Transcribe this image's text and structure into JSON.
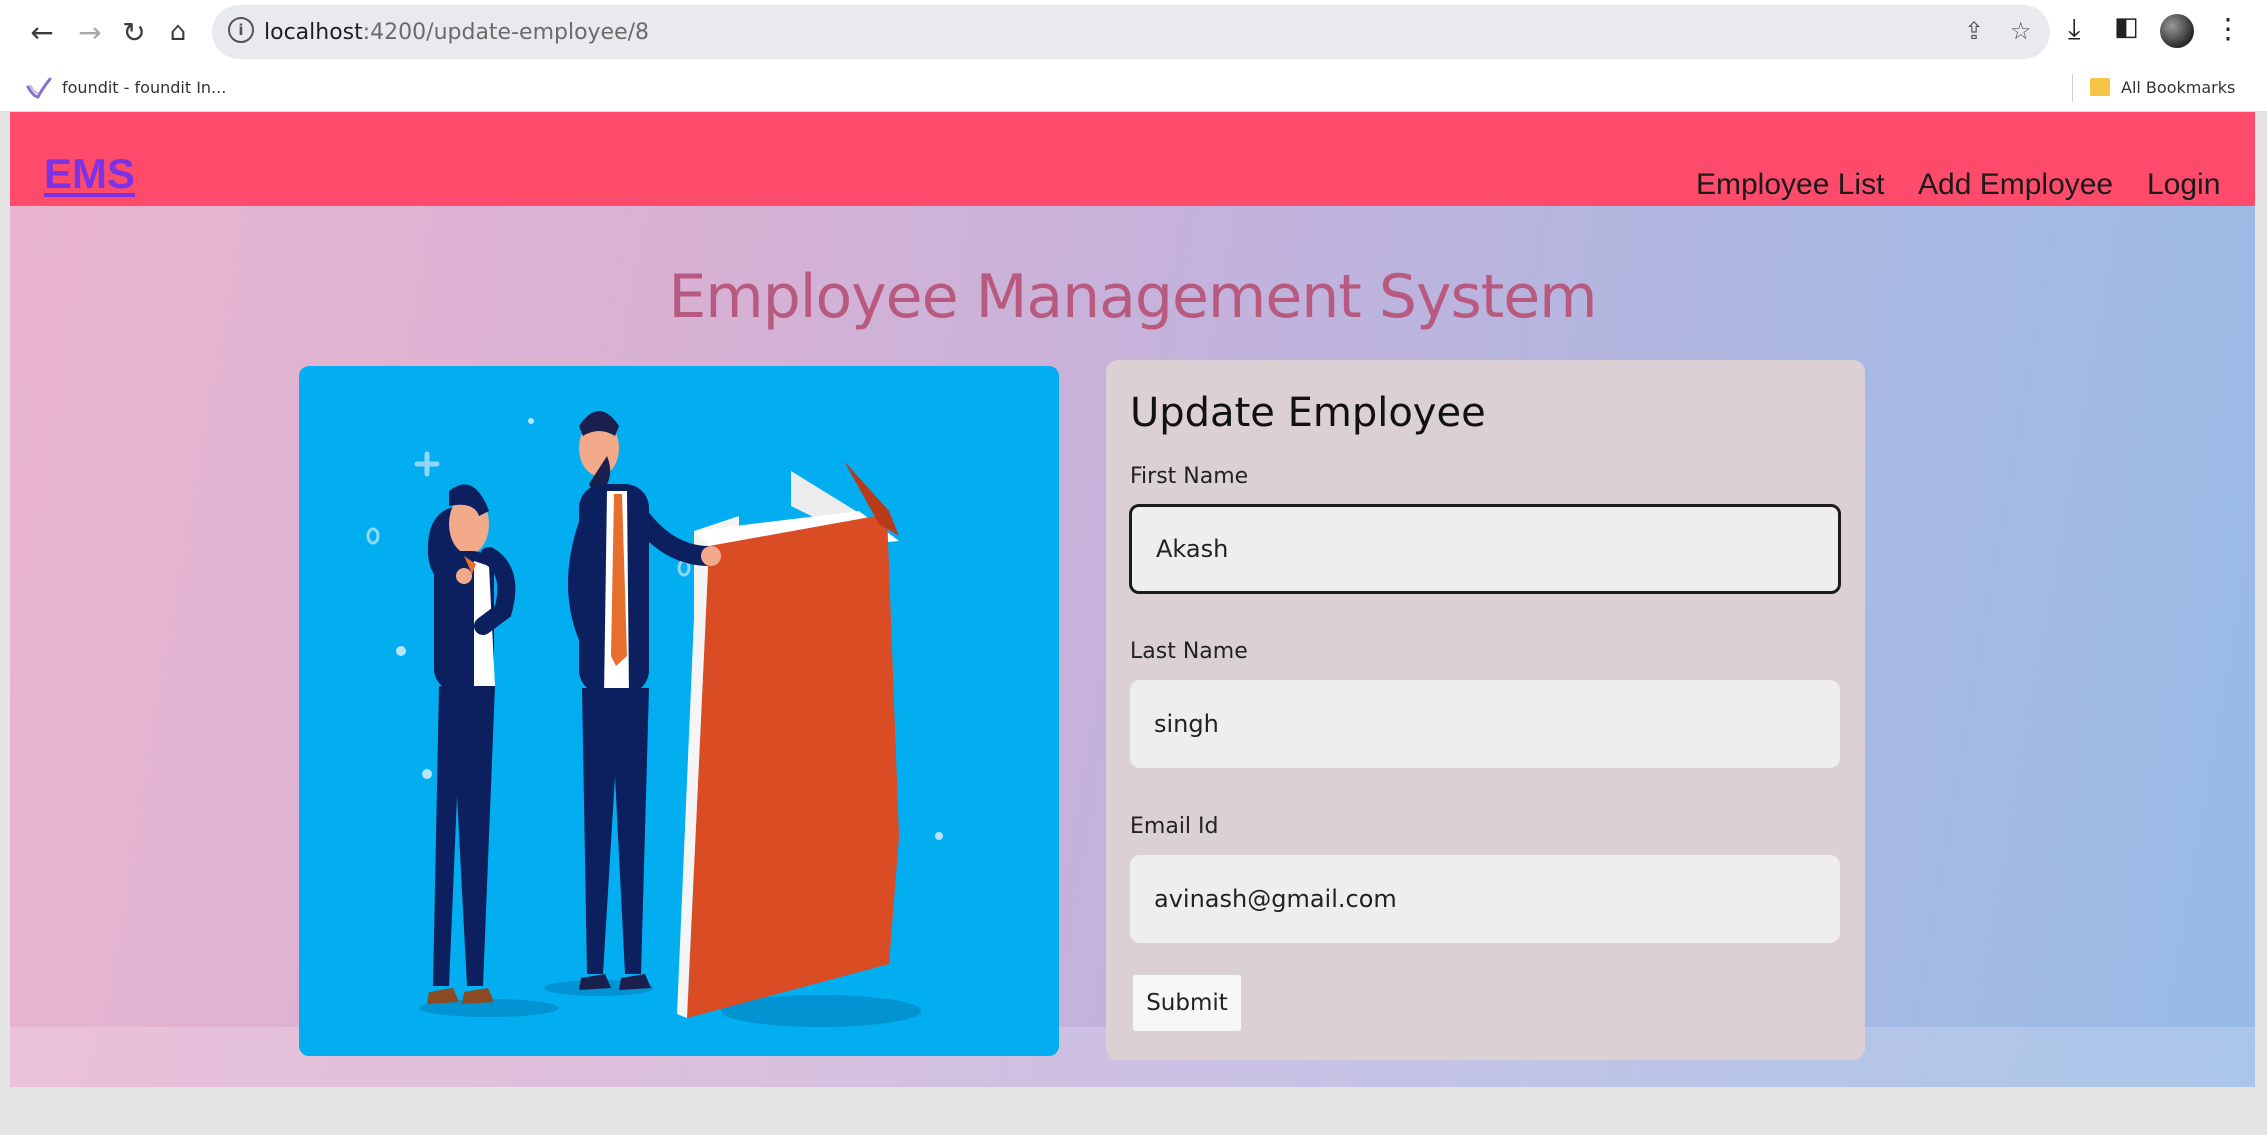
{
  "browser": {
    "url_host": "localhost",
    "url_path": ":4200/update-employee/8",
    "bookmark_label": "foundit - foundit In...",
    "all_bookmarks_label": "All Bookmarks",
    "icons": [
      "back-icon",
      "forward-icon",
      "reload-icon",
      "home-icon",
      "info-icon",
      "share-icon",
      "star-icon",
      "download-icon",
      "sidepanel-icon",
      "profile-avatar",
      "more-icon"
    ]
  },
  "navbar": {
    "brand": "EMS",
    "links": [
      "Employee List",
      "Add Employee",
      "Login"
    ],
    "background": "#ff4b6b",
    "brand_color": "#7c33e6"
  },
  "page": {
    "title": "Employee Management System",
    "title_color": "#b85a7f"
  },
  "form": {
    "heading": "Update Employee",
    "first_name_label": "First Name",
    "first_name_value": "Akash",
    "last_name_label": "Last Name",
    "last_name_value": "singh",
    "email_label": "Email Id",
    "email_value": "avinash@gmail.com",
    "submit_label": "Submit"
  },
  "illustration": {
    "background": "#02aeef",
    "book_color": "#d94c24"
  }
}
